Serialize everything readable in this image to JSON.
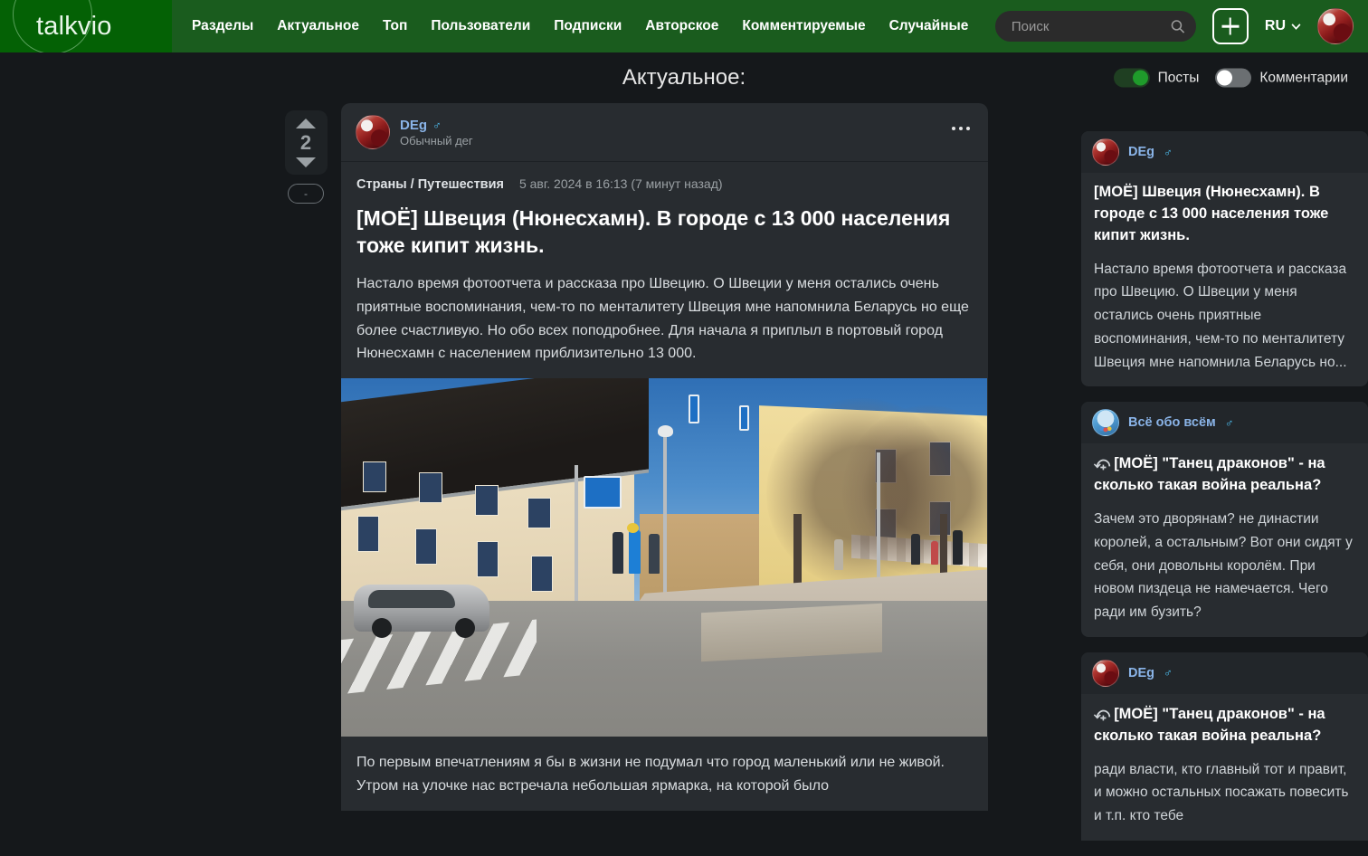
{
  "brand": {
    "name": "talkvio",
    "logo_bg": "#046105",
    "nav_bg": "#1a5c1e"
  },
  "nav": {
    "items": [
      {
        "label": "Разделы"
      },
      {
        "label": "Актуальное"
      },
      {
        "label": "Топ"
      },
      {
        "label": "Пользователи"
      },
      {
        "label": "Подписки"
      },
      {
        "label": "Авторское"
      },
      {
        "label": "Комментируемые"
      },
      {
        "label": "Случайные"
      }
    ],
    "search": {
      "placeholder": "Поиск",
      "value": "",
      "icon": "search-icon"
    },
    "create": {
      "icon": "plus-icon"
    },
    "language": {
      "label": "RU",
      "icon": "chevron-down-icon"
    },
    "avatar": {
      "icon": "user-avatar"
    }
  },
  "page": {
    "title": "Актуальное:",
    "toggles": [
      {
        "label": "Посты",
        "state": "on",
        "color": "#1f9b2b"
      },
      {
        "label": "Комментарии",
        "state": "off",
        "color": "#6b6f72"
      }
    ]
  },
  "post": {
    "vote": {
      "count": "2",
      "up_icon": "arrow-up-icon",
      "down_icon": "arrow-down-icon",
      "minus_label": "-"
    },
    "author": {
      "name": "DEg",
      "gender": "♂",
      "subtitle": "Обычный дег"
    },
    "more_menu": {
      "icon": "more-dots-icon"
    },
    "category": "Страны / Путешествия",
    "timestamp": "5 авг. 2024 в 16:13 (7 минут назад)",
    "title_tag": "[МОЁ]",
    "title": " Швеция (Нюнесхамн). В городе с 13 000 населения тоже кипит жизнь.",
    "paragraph_1": "Настало время фотоотчета и рассказа про Швецию. О Швеции у меня остались очень приятные воспоминания, чем-то по менталитету Швеция мне напомнила Беларусь но еще более счастливую. Но обо всех поподробнее. Для начала я приплыл в портовый город Нюнесхамн с населением приблизительно 13 000.",
    "photo_alt": "Улица шведского города Нюнесхамн",
    "paragraph_2": "По первым впечатлениям я бы в жизни не подумал что город маленький  или не живой. Утром на улочке нас встречала небольшая ярмарка, на которой было"
  },
  "sidebar": {
    "cards": [
      {
        "author": "DEg",
        "gender": "♂",
        "avatar": "user-avatar-red",
        "reply": false,
        "title_tag": "[МОЁ]",
        "title": " Швеция (Нюнесхамн). В городе с 13 000 населения тоже кипит жизнь.",
        "text": "Настало время фотоотчета и рассказа про Швецию. О Швеции у меня остались очень приятные воспоминания, чем-то по менталитету Швеция мне напомнила Беларусь но..."
      },
      {
        "author": "Всё обо всём",
        "gender": "♂",
        "avatar": "community-avatar-globe",
        "reply": true,
        "reply_icon": "reply-arrow-icon",
        "title_tag": "[МОЁ]",
        "title": " \"Танец драконов\" - на сколько такая война реальна?",
        "text": "Зачем это дворянам? не династии королей, а остальным? Вот они сидят у себя, они довольны королём. При новом пиздеца не намечается. Чего ради им бузить?"
      },
      {
        "author": "DEg",
        "gender": "♂",
        "avatar": "user-avatar-red",
        "reply": true,
        "reply_icon": "reply-arrow-icon",
        "title_tag": "[МОЁ]",
        "title": " \"Танец драконов\" - на сколько такая война реальна?",
        "text": "ради власти, кто главный тот и правит, и можно остальных посажать повесить и т.п. кто тебе"
      }
    ]
  }
}
